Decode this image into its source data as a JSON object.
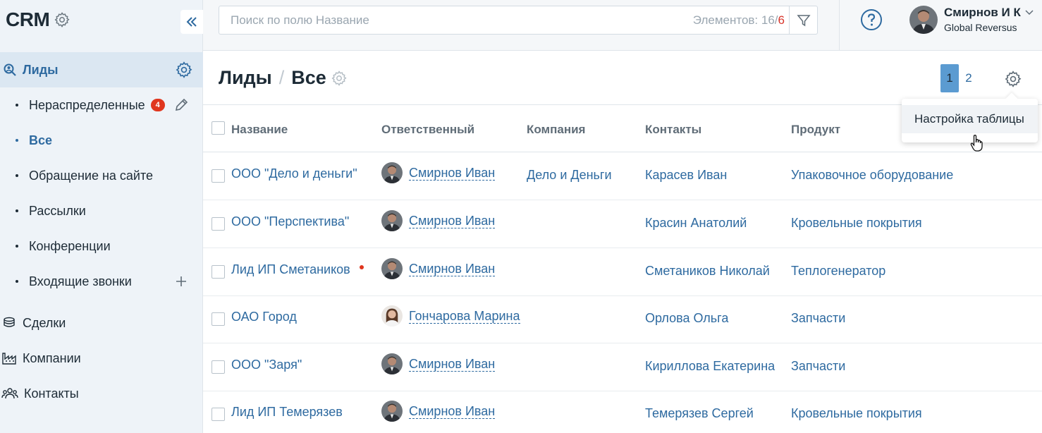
{
  "sidebar": {
    "brand": "CRM",
    "leads": {
      "label": "Лиды"
    },
    "subitems": [
      {
        "label": "Нераспределенные",
        "badge": "4"
      },
      {
        "label": "Все"
      },
      {
        "label": "Обращение на сайте"
      },
      {
        "label": "Рассылки"
      },
      {
        "label": "Конференции"
      },
      {
        "label": "Входящие звонки"
      }
    ],
    "sections": [
      {
        "label": "Сделки",
        "icon": "coins-icon"
      },
      {
        "label": "Компании",
        "icon": "factory-icon"
      },
      {
        "label": "Контакты",
        "icon": "people-icon"
      }
    ]
  },
  "topbar": {
    "search_placeholder": "Поиск по полю Название",
    "count_label": "Элементов: 16",
    "count_sep": "/",
    "count_extra": "6",
    "user_name": "Смирнов И К",
    "user_org": "Global Reversus"
  },
  "header": {
    "crumb_root": "Лиды",
    "crumb_sep": "/",
    "crumb_current": "Все",
    "pages": [
      "1",
      "2"
    ],
    "active_page": "1"
  },
  "dropdown": {
    "item": "Настройка таблицы"
  },
  "table": {
    "columns": [
      "Название",
      "Ответственный",
      "Компания",
      "Контакты",
      "Продукт"
    ],
    "rows": [
      {
        "name": "ООО \"Дело и деньги\"",
        "responsible": "Смирнов Иван",
        "company": "Дело и Деньги",
        "contact": "Карасев Иван",
        "product": "Упаковочное оборудование",
        "flag": false,
        "avatar": "male"
      },
      {
        "name": "ООО \"Перспектива\"",
        "responsible": "Смирнов Иван",
        "company": "",
        "contact": "Красин Анатолий",
        "product": "Кровельные покрытия",
        "flag": false,
        "avatar": "male"
      },
      {
        "name": "Лид ИП Сметаников",
        "responsible": "Смирнов Иван",
        "company": "",
        "contact": "Сметаников Николай",
        "product": "Теплогенератор",
        "flag": true,
        "avatar": "male"
      },
      {
        "name": "ОАО Город",
        "responsible": "Гончарова Марина",
        "company": "",
        "contact": "Орлова Ольга",
        "product": "Запчасти",
        "flag": false,
        "avatar": "female"
      },
      {
        "name": "ООО \"Заря\"",
        "responsible": "Смирнов Иван",
        "company": "",
        "contact": "Кириллова Екатерина",
        "product": "Запчасти",
        "flag": false,
        "avatar": "male"
      },
      {
        "name": "Лид ИП Темерязев",
        "responsible": "Смирнов Иван",
        "company": "",
        "contact": "Темерязев Сергей",
        "product": "Кровельные покрытия",
        "flag": false,
        "avatar": "male"
      }
    ]
  },
  "colors": {
    "accent": "#2e6aa0",
    "badge": "#e0361e",
    "sidebar_bg": "#eef3f8",
    "active_page": "#5b9bd1"
  }
}
